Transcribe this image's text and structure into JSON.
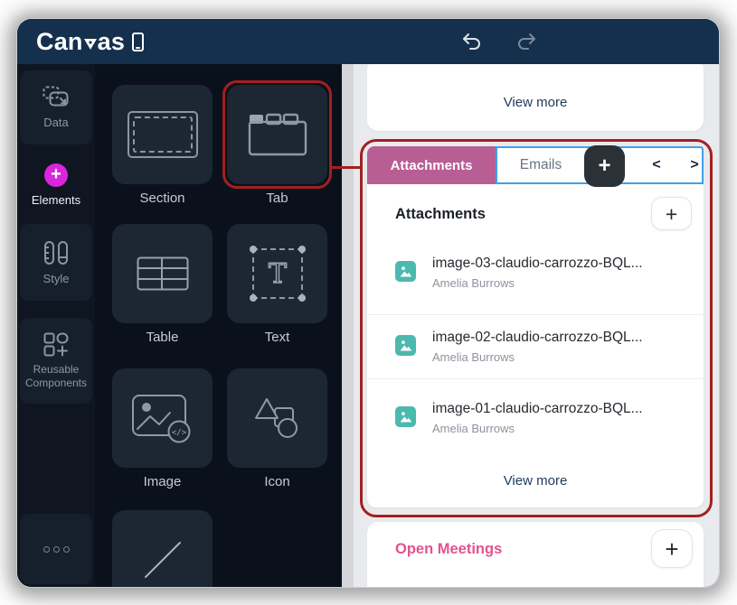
{
  "logo": {
    "pre": "Can",
    "post": "as"
  },
  "toolbar": {
    "undo_icon": "undo-arrow-icon",
    "redo_icon": "redo-arrow-icon",
    "phone_icon": "mobile-preview-icon"
  },
  "sidebar": {
    "items": [
      {
        "label": "Data",
        "icon": "data-icon",
        "active": false
      },
      {
        "label": "Elements",
        "icon": "plus-circle-icon",
        "active": true
      },
      {
        "label": "Style",
        "icon": "style-icon",
        "active": false
      },
      {
        "label": "Reusable Components",
        "icon": "reusable-components-icon",
        "active": false
      },
      {
        "label": "",
        "icon": "more-dots-icon",
        "active": false
      }
    ]
  },
  "elements_panel": {
    "tiles": [
      {
        "label": "Section",
        "icon": "section-icon",
        "highlighted": false
      },
      {
        "label": "Tab",
        "icon": "tab-icon",
        "highlighted": true
      },
      {
        "label": "Table",
        "icon": "table-icon",
        "highlighted": false
      },
      {
        "label": "Text",
        "icon": "text-icon",
        "highlighted": false
      },
      {
        "label": "Image",
        "icon": "image-icon",
        "highlighted": false
      },
      {
        "label": "Icon",
        "icon": "shapes-icon",
        "highlighted": false
      },
      {
        "label": "",
        "icon": "line-icon",
        "highlighted": false
      }
    ]
  },
  "preview": {
    "top_card": {
      "action": "View more"
    },
    "tab_component": {
      "tabs": [
        {
          "label": "Attachments",
          "active": true
        },
        {
          "label": "Emails",
          "active": false
        }
      ],
      "add_tab_label": "+",
      "prev_label": "<",
      "next_label": ">"
    },
    "attachments": {
      "title": "Attachments",
      "add_label": "+",
      "items": [
        {
          "name": "image-03-claudio-carrozzo-BQL...",
          "owner": "Amelia Burrows"
        },
        {
          "name": "image-02-claudio-carrozzo-BQL...",
          "owner": "Amelia Burrows"
        },
        {
          "name": "image-01-claudio-carrozzo-BQL...",
          "owner": "Amelia Burrows"
        }
      ],
      "action": "View more"
    },
    "open_meetings": {
      "title": "Open Meetings",
      "add_label": "+"
    }
  },
  "colors": {
    "header_navy": "#15304c",
    "accent_magenta": "#d726dc",
    "tab_active_pink": "#b85e95",
    "selection_red": "#a32020",
    "selection_blue": "#41a0e9",
    "thumb_teal": "#4cb9ae",
    "link_navy": "#1e3a5c",
    "open_meetings_pink": "#e2538f"
  }
}
